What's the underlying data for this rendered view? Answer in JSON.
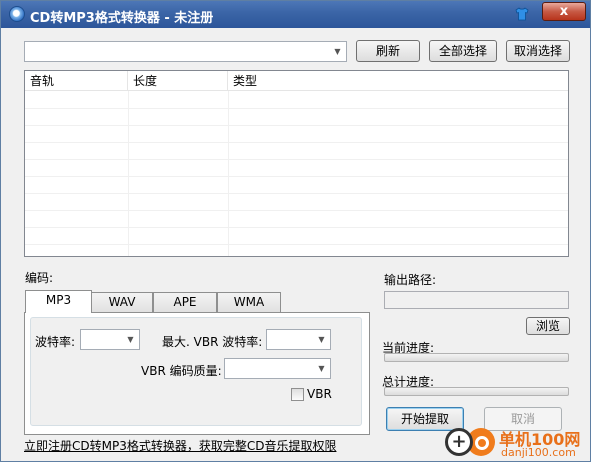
{
  "window": {
    "title": "CD转MP3格式转换器 - 未注册",
    "close_label": "x"
  },
  "toolbar": {
    "source_combo_value": "",
    "refresh_label": "刷新",
    "select_all_label": "全部选择",
    "deselect_label": "取消选择"
  },
  "tracks": {
    "columns": [
      "音轨",
      "长度",
      "类型"
    ],
    "rows": []
  },
  "encoding": {
    "section_label": "编码:",
    "tabs": [
      "MP3",
      "WAV",
      "APE",
      "WMA"
    ],
    "active_tab": "MP3",
    "bitrate_label": "波特率:",
    "bitrate_value": "",
    "max_vbr_label": "最大. VBR 波特率:",
    "max_vbr_value": "",
    "vbr_quality_label": "VBR 编码质量:",
    "vbr_quality_value": "",
    "vbr_checkbox_label": "VBR",
    "vbr_checked": false
  },
  "output": {
    "path_label": "输出路径:",
    "path_value": "",
    "browse_label": "浏览",
    "current_progress_label": "当前进度:",
    "current_progress": 0,
    "total_progress_label": "总计进度:",
    "total_progress": 0,
    "start_label": "开始提取",
    "cancel_label": "取消"
  },
  "footer": {
    "register_link": "立即注册CD转MP3格式转换器，获取完整CD音乐提取权限"
  },
  "watermark": {
    "brand": "单机100网",
    "domain": "danji100.com"
  },
  "colors": {
    "titlebar": "#3a64a6",
    "close_button": "#c75a45",
    "watermark": "#e8701a"
  }
}
